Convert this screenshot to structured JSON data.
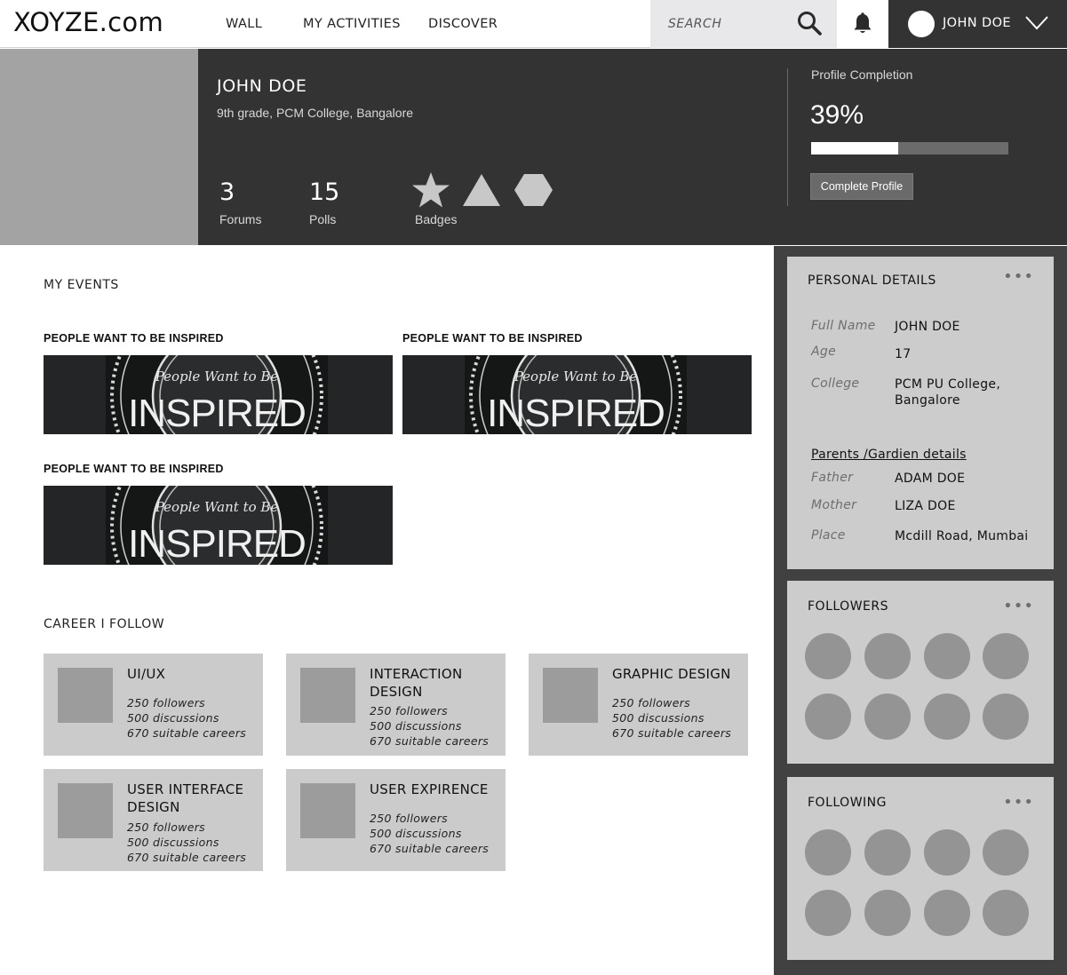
{
  "brand": {
    "logo": "XOYZE.com"
  },
  "nav": {
    "links": [
      "WALL",
      "MY ACTIVITIES",
      "DISCOVER"
    ]
  },
  "search": {
    "placeholder": "SEARCH"
  },
  "user": {
    "name": "JOHN DOE"
  },
  "profile": {
    "name": "JOHN DOE",
    "subtitle": "9th grade, PCM College, Bangalore",
    "stats": [
      {
        "value": "3",
        "label": "Forums"
      },
      {
        "value": "15",
        "label": "Polls"
      }
    ],
    "badges_label": "Badges",
    "badges": [
      "star-badge",
      "triangle-badge",
      "hexagon-badge"
    ],
    "completion": {
      "title": "Profile Completion",
      "percent_text": "39%",
      "fraction": 0.44,
      "button": "Complete Profile"
    }
  },
  "events": {
    "title": "MY EVENTS",
    "items": [
      {
        "title": "PEOPLE WANT TO BE INSPIRED"
      },
      {
        "title": "PEOPLE WANT TO BE INSPIRED"
      },
      {
        "title": "PEOPLE WANT TO BE INSPIRED"
      }
    ],
    "banner_text": {
      "top": "People Want to Be",
      "main": "INSPIRED"
    }
  },
  "careers": {
    "title": "CAREER I FOLLOW",
    "items": [
      {
        "title": "UI/UX",
        "followers": "250 followers",
        "discussions": "500 discussions",
        "careers": "670 suitable careers"
      },
      {
        "title": "INTERACTION DESIGN",
        "followers": "250 followers",
        "discussions": "500 discussions",
        "careers": "670 suitable careers"
      },
      {
        "title": "GRAPHIC DESIGN",
        "followers": "250 followers",
        "discussions": "500 discussions",
        "careers": "670 suitable careers"
      },
      {
        "title": "USER INTERFACE DESIGN",
        "followers": "250 followers",
        "discussions": "500 discussions",
        "careers": "670 suitable careers"
      },
      {
        "title": "USER EXPIRENCE",
        "followers": "250 followers",
        "discussions": "500 discussions",
        "careers": "670 suitable careers"
      }
    ]
  },
  "personal_details": {
    "title": "PERSONAL DETAILS",
    "menu": "•••",
    "fields": [
      {
        "label": "Full Name",
        "value": "JOHN DOE"
      },
      {
        "label": "Age",
        "value": "17"
      },
      {
        "label": "College",
        "value": "PCM PU College, Bangalore"
      }
    ],
    "parents_link": "Parents /Gardien details",
    "parents": [
      {
        "label": "Father",
        "value": "ADAM DOE"
      },
      {
        "label": "Mother",
        "value": "LIZA DOE"
      },
      {
        "label": "Place",
        "value": "Mcdill Road, Mumbai"
      }
    ]
  },
  "followers": {
    "title": "FOLLOWERS",
    "menu": "•••"
  },
  "following": {
    "title": "FOLLOWING",
    "menu": "•••"
  }
}
